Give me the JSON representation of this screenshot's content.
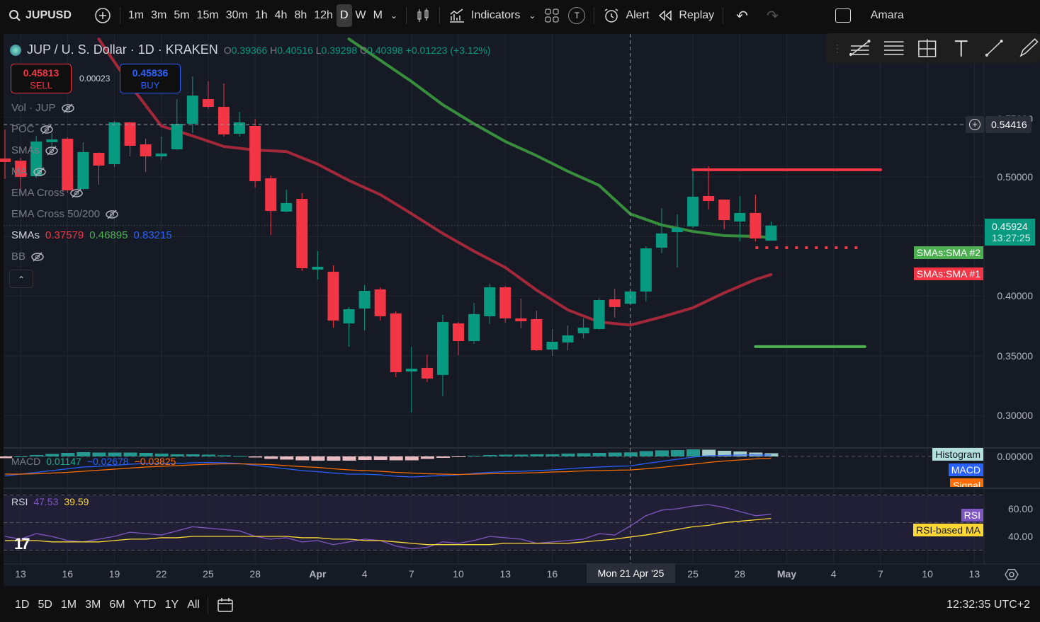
{
  "toolbar": {
    "symbol": "JUPUSD",
    "intervals": [
      "1m",
      "3m",
      "5m",
      "15m",
      "30m",
      "1h",
      "4h",
      "8h",
      "12h",
      "D",
      "W",
      "M"
    ],
    "selected_interval": "D",
    "indicators_label": "Indicators",
    "alert_label": "Alert",
    "replay_label": "Replay",
    "template_letter": "T",
    "user": "Amara"
  },
  "header": {
    "title": "JUP / U. S. Dollar · 1D · KRAKEN",
    "o_label": "O",
    "o": "0.39366",
    "h_label": "H",
    "h": "0.40516",
    "l_label": "L",
    "l": "0.39298",
    "c_label": "C",
    "c": "0.40398",
    "change": "+0.01223 (+3.12%)"
  },
  "trade": {
    "sell_price": "0.45813",
    "sell_label": "SELL",
    "spread": "0.00023",
    "buy_price": "0.45836",
    "buy_label": "BUY"
  },
  "indicators_legend": [
    {
      "label": "Vol · JUP",
      "hidden": true
    },
    {
      "label": "POC",
      "hidden": true
    },
    {
      "label": "SMAs",
      "hidden": true
    },
    {
      "label": "MA",
      "hidden": true
    },
    {
      "label": "EMA Cross",
      "hidden": true
    },
    {
      "label": "EMA Cross 50/200",
      "hidden": true
    }
  ],
  "smas_legend": {
    "label": "SMAs",
    "v1": "0.37579",
    "v2": "0.46895",
    "v3": "0.83215"
  },
  "bb_legend": {
    "label": "BB"
  },
  "macd_legend": {
    "label": "MACD",
    "hist": "0.01147",
    "macd": "−0.02678",
    "signal": "−0.03825"
  },
  "rsi_legend": {
    "label": "RSI",
    "rsi": "47.53",
    "ma": "39.59"
  },
  "price_axis": {
    "ticks": [
      "0.55000",
      "0.50000",
      "0.40000",
      "0.35000",
      "0.30000"
    ],
    "crosshair_price": "0.54416",
    "last_price": "0.45924",
    "countdown": "13:27:25",
    "sma2_tag": "SMAs:SMA #2",
    "sma1_tag": "SMAs:SMA #1",
    "macd_zero": "0.00000",
    "histogram_tag": "Histogram",
    "macd_tag": "MACD",
    "signal_tag": "Signal",
    "rsi_ticks": [
      "60.00",
      "40.00"
    ],
    "rsi_tag": "RSI",
    "rsi_ma_tag": "RSI-based MA"
  },
  "time_axis": {
    "ticks": [
      {
        "label": "13",
        "i": 1
      },
      {
        "label": "16",
        "i": 4
      },
      {
        "label": "19",
        "i": 7
      },
      {
        "label": "22",
        "i": 10
      },
      {
        "label": "25",
        "i": 13
      },
      {
        "label": "28",
        "i": 16
      },
      {
        "label": "Apr",
        "i": 20
      },
      {
        "label": "4",
        "i": 23
      },
      {
        "label": "7",
        "i": 26
      },
      {
        "label": "10",
        "i": 29
      },
      {
        "label": "13",
        "i": 32
      },
      {
        "label": "16",
        "i": 35
      },
      {
        "label": "25",
        "i": 44
      },
      {
        "label": "28",
        "i": 47
      },
      {
        "label": "May",
        "i": 50
      },
      {
        "label": "4",
        "i": 53
      },
      {
        "label": "7",
        "i": 56
      },
      {
        "label": "10",
        "i": 59
      },
      {
        "label": "13",
        "i": 62
      }
    ],
    "crosshair_label": "Mon 21 Apr '25",
    "crosshair_index": 40
  },
  "bottom": {
    "ranges": [
      "1D",
      "5D",
      "1M",
      "3M",
      "6M",
      "YTD",
      "1Y",
      "All"
    ],
    "clock": "12:32:35 UTC+2"
  },
  "colors": {
    "up": "#089981",
    "down": "#f23645",
    "sma1": "#a3283a",
    "sma2": "#388e3c",
    "macd": "#2962ff",
    "signal": "#ff6d00",
    "rsi": "#7e57c2",
    "rsi_ma": "#fdd835",
    "hist": "#b2dfdb"
  },
  "chart_data": {
    "type": "candlestick",
    "first_date": "Mar 12",
    "ohlc": [
      [
        0.5154,
        0.5397,
        0.4982,
        0.5125
      ],
      [
        0.5136,
        0.516,
        0.4893,
        0.5
      ],
      [
        0.5006,
        0.5344,
        0.499,
        0.5297
      ],
      [
        0.5291,
        0.5368,
        0.5255,
        0.5314
      ],
      [
        0.532,
        0.5332,
        0.4864,
        0.4887
      ],
      [
        0.4899,
        0.5291,
        0.489,
        0.5208
      ],
      [
        0.5202,
        0.5205,
        0.4935,
        0.5095
      ],
      [
        0.5107,
        0.5468,
        0.5083,
        0.5457
      ],
      [
        0.5457,
        0.546,
        0.5172,
        0.5261
      ],
      [
        0.5273,
        0.532,
        0.5042,
        0.5172
      ],
      [
        0.5172,
        0.5338,
        0.5142,
        0.5196
      ],
      [
        0.5231,
        0.5652,
        0.5225,
        0.5445
      ],
      [
        0.5445,
        0.5842,
        0.5368,
        0.5682
      ],
      [
        0.5652,
        0.5801,
        0.5569,
        0.5587
      ],
      [
        0.5587,
        0.5783,
        0.5338,
        0.5356
      ],
      [
        0.5362,
        0.5546,
        0.5338,
        0.5457
      ],
      [
        0.5427,
        0.5486,
        0.4911,
        0.4964
      ],
      [
        0.4988,
        0.5012,
        0.4514,
        0.4715
      ],
      [
        0.4709,
        0.4893,
        0.4703,
        0.4781
      ],
      [
        0.4816,
        0.4864,
        0.4211,
        0.4235
      ],
      [
        0.4223,
        0.4377,
        0.414,
        0.4247
      ],
      [
        0.4205,
        0.4259,
        0.3737,
        0.3796
      ],
      [
        0.3772,
        0.3909,
        0.3577,
        0.3891
      ],
      [
        0.3897,
        0.4093,
        0.3713,
        0.4045
      ],
      [
        0.4057,
        0.4075,
        0.3796,
        0.3832
      ],
      [
        0.3856,
        0.3873,
        0.3322,
        0.3363
      ],
      [
        0.3369,
        0.3577,
        0.3025,
        0.3393
      ],
      [
        0.3399,
        0.3512,
        0.328,
        0.331
      ],
      [
        0.334,
        0.3844,
        0.3162,
        0.3784
      ],
      [
        0.3772,
        0.3784,
        0.3506,
        0.3624
      ],
      [
        0.3624,
        0.3944,
        0.3601,
        0.385
      ],
      [
        0.3832,
        0.4105,
        0.3767,
        0.4075
      ],
      [
        0.4075,
        0.4087,
        0.3778,
        0.3814
      ],
      [
        0.3814,
        0.398,
        0.3731,
        0.379
      ],
      [
        0.3808,
        0.3879,
        0.3541,
        0.3547
      ],
      [
        0.3553,
        0.3725,
        0.35,
        0.3618
      ],
      [
        0.3612,
        0.3755,
        0.3547,
        0.3672
      ],
      [
        0.3689,
        0.3814,
        0.3648,
        0.3737
      ],
      [
        0.3725,
        0.3986,
        0.3719,
        0.3968
      ],
      [
        0.3974,
        0.4063,
        0.382,
        0.3909
      ],
      [
        0.39366,
        0.40516,
        0.39298,
        0.40398
      ],
      [
        0.4039,
        0.4419,
        0.3956,
        0.4401
      ],
      [
        0.4407,
        0.4739,
        0.436,
        0.4526
      ],
      [
        0.4537,
        0.4686,
        0.4241,
        0.4573
      ],
      [
        0.4585,
        0.5059,
        0.4573,
        0.4834
      ],
      [
        0.484,
        0.5089,
        0.4727,
        0.4798
      ],
      [
        0.481,
        0.481,
        0.4561,
        0.4638
      ],
      [
        0.4626,
        0.484,
        0.446,
        0.4698
      ],
      [
        0.4698,
        0.4852,
        0.446,
        0.4484
      ],
      [
        0.4466,
        0.4626,
        0.4466,
        0.45924
      ]
    ],
    "sma1": [
      [
        6,
        0.6156
      ],
      [
        8,
        0.5771
      ],
      [
        10,
        0.5427
      ],
      [
        12,
        0.5344
      ],
      [
        14,
        0.5255
      ],
      [
        16,
        0.5225
      ],
      [
        18,
        0.5213
      ],
      [
        20,
        0.5107
      ],
      [
        22,
        0.497
      ],
      [
        24,
        0.4852
      ],
      [
        26,
        0.4692
      ],
      [
        28,
        0.4526
      ],
      [
        30,
        0.4377
      ],
      [
        32,
        0.4241
      ],
      [
        34,
        0.4051
      ],
      [
        36,
        0.3885
      ],
      [
        38,
        0.3784
      ],
      [
        40,
        0.37579
      ],
      [
        42,
        0.3826
      ],
      [
        44,
        0.3903
      ],
      [
        46,
        0.4028
      ],
      [
        48,
        0.414
      ],
      [
        49,
        0.4182
      ]
    ],
    "sma2": [
      [
        22,
        0.6156
      ],
      [
        24,
        0.5978
      ],
      [
        26,
        0.58
      ],
      [
        28,
        0.5605
      ],
      [
        30,
        0.5445
      ],
      [
        32,
        0.5297
      ],
      [
        34,
        0.5178
      ],
      [
        36,
        0.5047
      ],
      [
        38,
        0.4929
      ],
      [
        40,
        0.46895
      ],
      [
        42,
        0.4597
      ],
      [
        44,
        0.4543
      ],
      [
        46,
        0.4508
      ],
      [
        48,
        0.4502
      ],
      [
        49,
        0.449
      ]
    ],
    "drawings": [
      {
        "type": "hline",
        "color": "#f23645",
        "price": 0.506,
        "from": 44,
        "to": 56,
        "style": "solid"
      },
      {
        "type": "hline",
        "color": "#f23645",
        "price": 0.4407,
        "from": 48,
        "to": 55,
        "style": "dotted"
      },
      {
        "type": "hline",
        "color": "#4caf50",
        "price": 0.3577,
        "from": 48,
        "to": 55,
        "style": "solid"
      }
    ],
    "macd": [
      -0.055,
      -0.05,
      -0.045,
      -0.04,
      -0.035,
      -0.03,
      -0.028,
      -0.025,
      -0.022,
      -0.02,
      -0.02,
      -0.02,
      -0.018,
      -0.017,
      -0.018,
      -0.02,
      -0.025,
      -0.03,
      -0.035,
      -0.04,
      -0.043,
      -0.047,
      -0.05,
      -0.05,
      -0.052,
      -0.056,
      -0.058,
      -0.056,
      -0.054,
      -0.052,
      -0.048,
      -0.045,
      -0.043,
      -0.042,
      -0.04,
      -0.038,
      -0.035,
      -0.032,
      -0.03,
      -0.028,
      -0.02678,
      -0.02,
      -0.014,
      -0.008,
      -0.002,
      0.002,
      0.003,
      0.004,
      0.004,
      0.004
    ],
    "signal": [
      -0.05,
      -0.05,
      -0.049,
      -0.047,
      -0.045,
      -0.042,
      -0.039,
      -0.036,
      -0.033,
      -0.03,
      -0.028,
      -0.026,
      -0.024,
      -0.022,
      -0.021,
      -0.021,
      -0.022,
      -0.023,
      -0.026,
      -0.029,
      -0.031,
      -0.035,
      -0.038,
      -0.04,
      -0.042,
      -0.045,
      -0.047,
      -0.049,
      -0.05,
      -0.051,
      -0.05,
      -0.049,
      -0.048,
      -0.047,
      -0.046,
      -0.044,
      -0.043,
      -0.041,
      -0.04,
      -0.039,
      -0.03825,
      -0.035,
      -0.031,
      -0.026,
      -0.022,
      -0.017,
      -0.013,
      -0.01,
      -0.007,
      -0.005
    ],
    "rsi": [
      40,
      38,
      42,
      40,
      37,
      36,
      38,
      40,
      43,
      42,
      41,
      44,
      47,
      46,
      45,
      44,
      40,
      38,
      39,
      36,
      37,
      34,
      36,
      38,
      37,
      33,
      31,
      32,
      36,
      35,
      37,
      40,
      39,
      38,
      35,
      36,
      37,
      38,
      42,
      41,
      47.53,
      55,
      59,
      60,
      62,
      63,
      61,
      58,
      55,
      56
    ],
    "rsi_ma": [
      37,
      37,
      37,
      36,
      36,
      36,
      36,
      37,
      38,
      38,
      39,
      39,
      40,
      40,
      40,
      40,
      40,
      40,
      40,
      39,
      39,
      38,
      38,
      37,
      37,
      36,
      35,
      34,
      34,
      34,
      34,
      34,
      35,
      35,
      35,
      35,
      35,
      36,
      37,
      38,
      39.59,
      41,
      43,
      45,
      47,
      48,
      50,
      51,
      52,
      53
    ],
    "ylim": [
      0.28,
      0.6
    ],
    "rsi_levels": [
      30,
      70
    ]
  }
}
